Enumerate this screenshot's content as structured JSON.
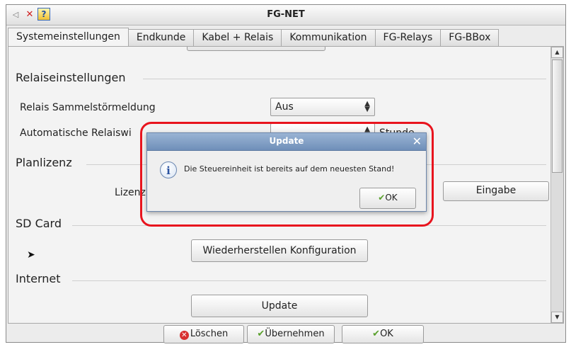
{
  "window": {
    "title": "FG-NET"
  },
  "tabs": [
    "Systemeinstellungen",
    "Endkunde",
    "Kabel + Relais",
    "Kommunikation",
    "FG-Relays",
    "FG-BBox"
  ],
  "panel": {
    "relais_section": "Relaiseinstellungen",
    "sammelstoer_label": "Relais Sammelstörmeldung",
    "sammelstoer_value": "Aus",
    "auto_label": "Automatische Relaiswi",
    "auto_unit": "Stunde",
    "planlizenz_section": "Planlizenz",
    "lizenz_label": "Lizenz",
    "eingabe_button": "Eingabe",
    "sdcard_section": "SD Card",
    "restore_button": "Wiederherstellen Konfiguration",
    "internet_section": "Internet",
    "update_button": "Update"
  },
  "dialog": {
    "title": "Update",
    "message": "Die Steuereinheit ist bereits auf dem neuesten Stand!",
    "ok_label": "OK"
  },
  "footer": {
    "delete_label": "Löschen",
    "apply_label": "Übernehmen",
    "ok_label": "OK"
  },
  "colors": {
    "highlight": "#e8141e",
    "dialog_title": "#7f9ec6"
  }
}
